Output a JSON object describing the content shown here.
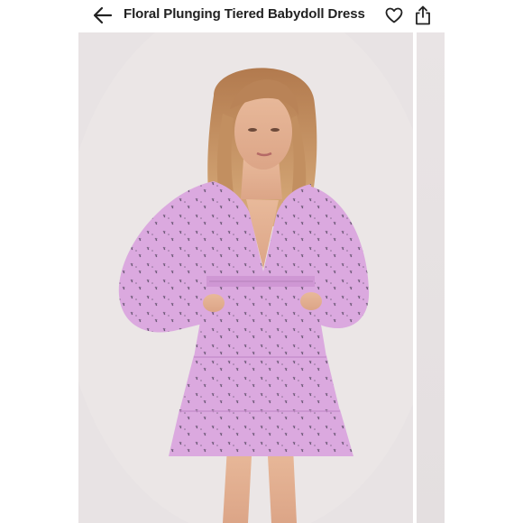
{
  "header": {
    "title": "Floral Plunging Tiered Babydoll Dress",
    "back_icon": "arrow-left-icon",
    "like_icon": "heart-outline-icon",
    "share_icon": "share-icon"
  },
  "colors": {
    "header_bg": "#ffffff",
    "title_text": "#222222",
    "icon_color": "#222222",
    "photo_bg": "#e8e3e4",
    "dress": "#d9a8de"
  },
  "gallery": {
    "main_image": "product-photo",
    "peek_image": "next-product-photo"
  }
}
